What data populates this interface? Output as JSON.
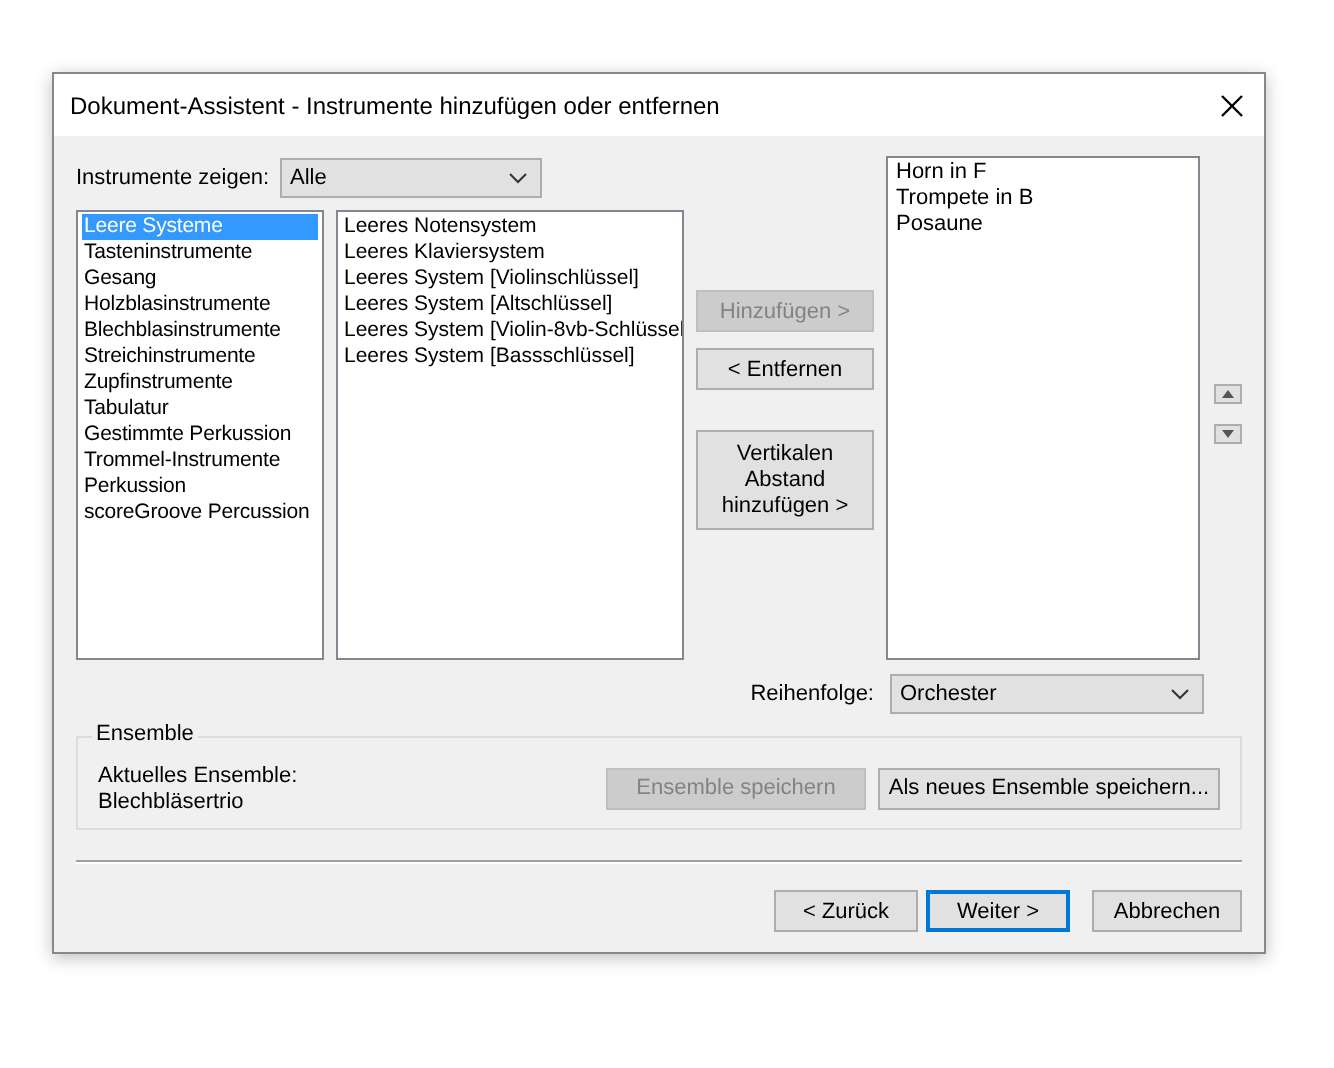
{
  "window": {
    "title": "Dokument-Assistent - Instrumente hinzufügen oder entfernen"
  },
  "filter": {
    "label": "Instrumente zeigen:",
    "value": "Alle"
  },
  "categories": [
    {
      "label": "Leere Systeme",
      "selected": true
    },
    {
      "label": "Tasteninstrumente",
      "selected": false
    },
    {
      "label": "Gesang",
      "selected": false
    },
    {
      "label": "Holzblasinstrumente",
      "selected": false
    },
    {
      "label": "Blechblasinstrumente",
      "selected": false
    },
    {
      "label": "Streichinstrumente",
      "selected": false
    },
    {
      "label": "Zupfinstrumente",
      "selected": false
    },
    {
      "label": "Tabulatur",
      "selected": false
    },
    {
      "label": "Gestimmte Perkussion",
      "selected": false
    },
    {
      "label": "Trommel-Instrumente",
      "selected": false
    },
    {
      "label": "Perkussion",
      "selected": false
    },
    {
      "label": "scoreGroove Percussion",
      "selected": false
    }
  ],
  "instruments": [
    {
      "label": "Leeres Notensystem",
      "selected": false
    },
    {
      "label": "Leeres Klaviersystem",
      "selected": false
    },
    {
      "label": "Leeres System [Violinschlüssel]",
      "selected": false
    },
    {
      "label": "Leeres System [Altschlüssel]",
      "selected": false
    },
    {
      "label": "Leeres System [Violin-8vb-Schlüssel",
      "selected": false
    },
    {
      "label": "Leeres System [Bassschlüssel]",
      "selected": false
    }
  ],
  "actions": [
    {
      "label": "Hinzufügen >",
      "disabled": true
    },
    {
      "label": "< Entfernen",
      "disabled": false
    },
    {
      "label": "Vertikalen Abstand hinzufügen >",
      "disabled": false
    }
  ],
  "score": [
    {
      "label": "Horn in F",
      "selected": false
    },
    {
      "label": "Trompete in B",
      "selected": false
    },
    {
      "label": "Posaune",
      "selected": false
    }
  ],
  "order": {
    "label": "Reihenfolge:",
    "value": "Orchester"
  },
  "ensemble": {
    "title": "Ensemble",
    "current_label": "Aktuelles Ensemble:",
    "current_value": "Blechbläsertrio",
    "buttons": [
      {
        "label": "Ensemble speichern",
        "disabled": true
      },
      {
        "label": "Als neues Ensemble speichern...",
        "disabled": false
      }
    ]
  },
  "footer_buttons": [
    {
      "label": "< Zurück",
      "default": false
    },
    {
      "label": "Weiter >",
      "default": true
    },
    {
      "label": "Abbrechen",
      "default": false
    }
  ]
}
